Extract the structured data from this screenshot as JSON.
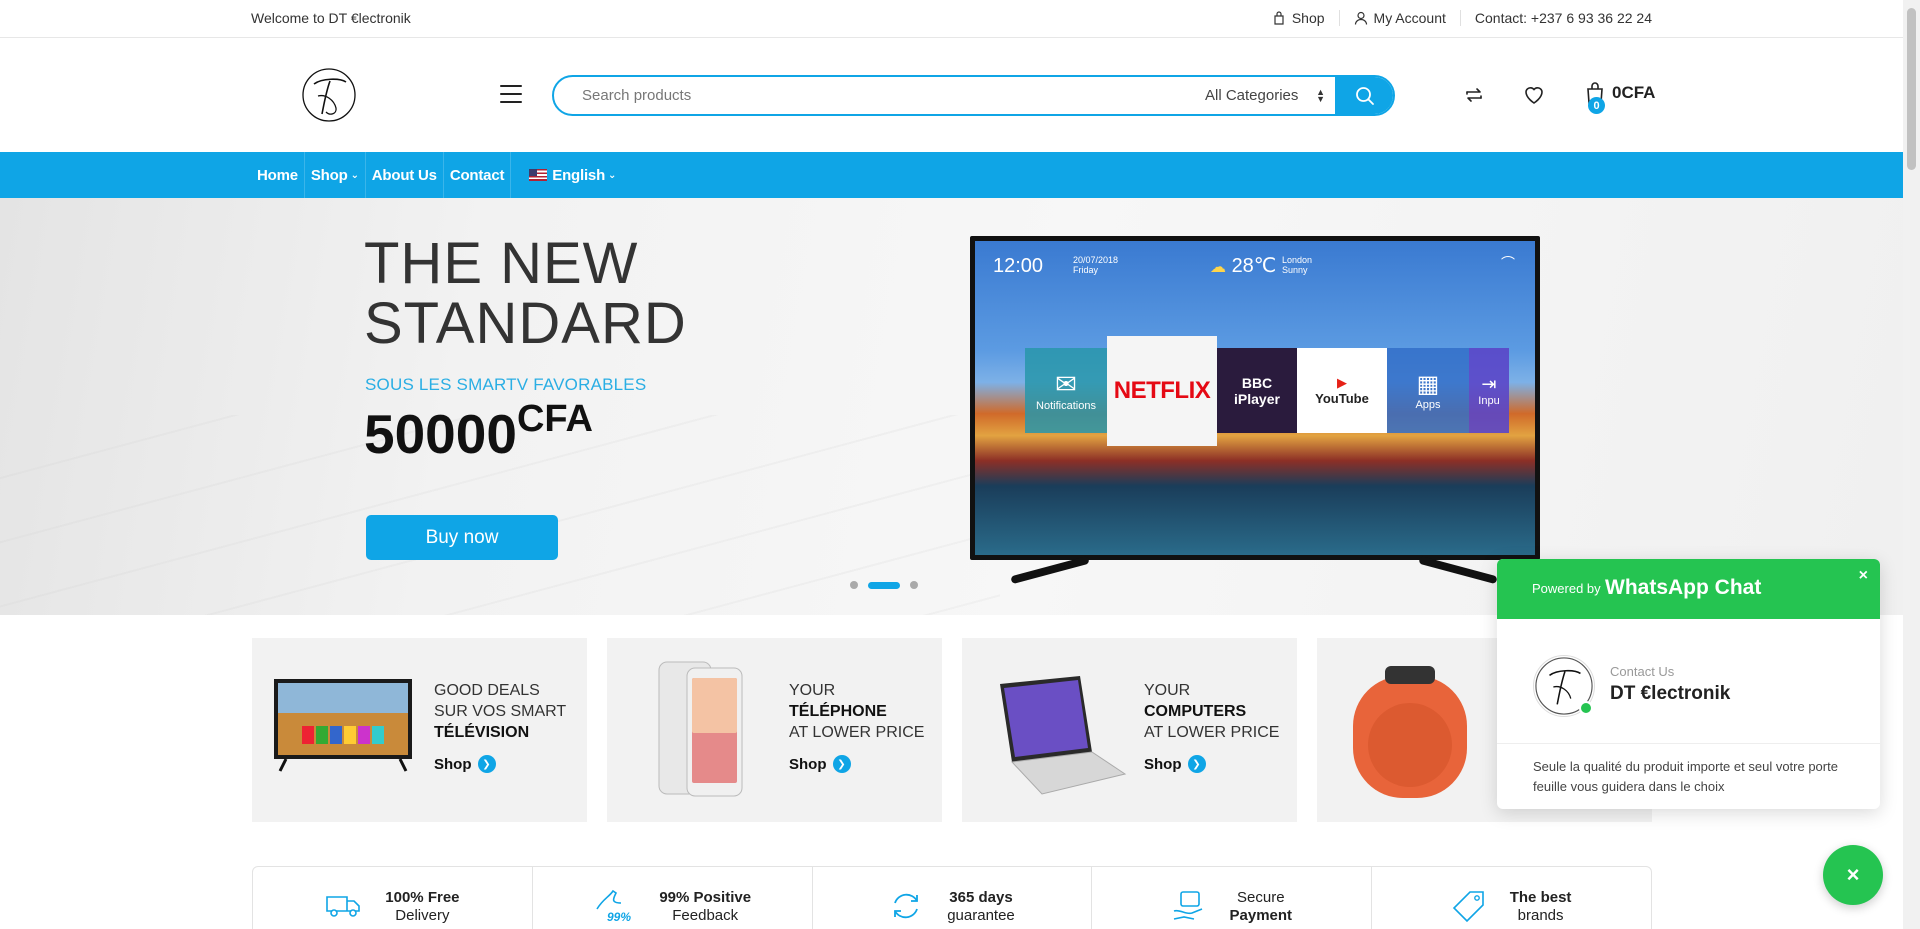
{
  "topbar": {
    "welcome": "Welcome to DT €lectronik",
    "shop": "Shop",
    "account": "My Account",
    "contact": "Contact: +237 6 93 36 22 24"
  },
  "header": {
    "search_placeholder": "Search products",
    "category": "All Categories",
    "cart_count": "0",
    "cart_total": "0CFA"
  },
  "nav": {
    "items": [
      "Home",
      "Shop",
      "About Us",
      "Contact",
      "English"
    ]
  },
  "hero": {
    "title_line1": "THE NEW",
    "title_line2": "STANDARD",
    "subtitle": "SOUS LES SMARTV FAVORABLES",
    "price": "50000",
    "currency": "CFA",
    "button": "Buy now",
    "active_slide": 2,
    "slides": 3,
    "tv": {
      "clock": "12:00",
      "date": "20/07/2018",
      "day": "Friday",
      "temp": "28℃",
      "city": "London",
      "weather": "Sunny",
      "tiles": [
        "Notifications",
        "NETFLIX",
        "BBC iPlayer",
        "YouTube",
        "Apps",
        "Inpu"
      ]
    }
  },
  "categories": [
    {
      "line1": "GOOD DEALS",
      "line2": "SUR VOS SMART",
      "line3": "TÉLÉVISION",
      "shop": "Shop"
    },
    {
      "line1": "YOUR",
      "line2": "TÉLÉPHONE",
      "line3": "AT LOWER PRICE",
      "shop": "Shop"
    },
    {
      "line1": "YOUR",
      "line2": "COMPUTERS",
      "line3": "AT LOWER PRICE",
      "shop": "Shop"
    }
  ],
  "features": [
    {
      "top": "100% Free",
      "bottom": "Delivery"
    },
    {
      "top": "99% Positive",
      "bottom": "Feedback"
    },
    {
      "top": "365 days",
      "bottom": "guarantee"
    },
    {
      "top": "Secure",
      "bottom": "Payment"
    },
    {
      "top": "The best",
      "bottom": "brands"
    }
  ],
  "whatsapp": {
    "powered_by": "Powered by",
    "title": "WhatsApp Chat",
    "close": "×",
    "contact_label": "Contact Us",
    "contact_name": "DT €lectronik",
    "message": "Seule la qualité du produit importe et seul votre porte feuille vous guidera dans le choix",
    "fab": "×"
  },
  "colors": {
    "accent": "#0fa5e6",
    "whatsapp": "#25c451"
  }
}
